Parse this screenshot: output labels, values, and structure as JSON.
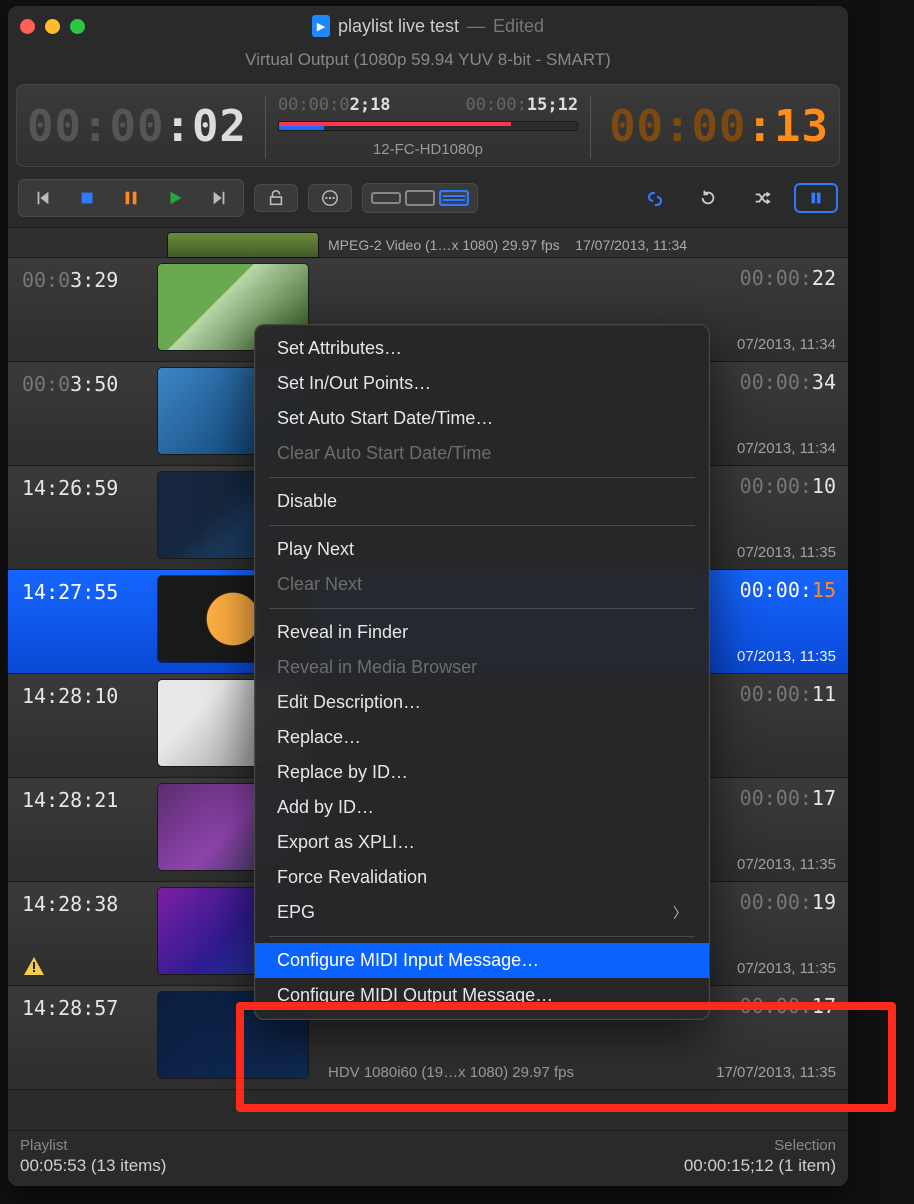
{
  "window": {
    "doc_name": "playlist live test",
    "edited": "Edited",
    "subtitle": "Virtual Output (1080p 59.94 YUV 8-bit - SMART)"
  },
  "timecode": {
    "left_dim": "00:00",
    "left_bright": ":02",
    "in_dim": "00:00:0",
    "in_bright": "2;18",
    "out_dim": "00:00:",
    "out_bright": "15;12",
    "right_dim": "00:00",
    "right_bright": ":13",
    "clip_name": "12-FC-HD1080p"
  },
  "toolbar": {
    "prev": "⏮",
    "stop": "■",
    "pause": "⏸",
    "play": "▶",
    "next": "⏭",
    "lock": "🔓",
    "more": "⋯",
    "link": "link",
    "reload": "↻",
    "shuffle": "⤨",
    "chain_pause": "⏸"
  },
  "partial_row": {
    "meta": "MPEG-2 Video (1…x 1080) 29.97 fps",
    "date": "17/07/2013, 11:34"
  },
  "rows": [
    {
      "start_dim": "00:0",
      "start_bright": "3:29",
      "dur_dim": "00:00:",
      "dur_bright": "22",
      "codec": "",
      "date": "07/2013, 11:34",
      "thumb": "th-a"
    },
    {
      "start_dim": "00:0",
      "start_bright": "3:50",
      "dur_dim": "00:00:",
      "dur_bright": "34",
      "codec": "",
      "date": "07/2013, 11:34",
      "thumb": "th-b"
    },
    {
      "start_dim": "",
      "start_bright": "14:26:59",
      "dur_dim": "00:00:",
      "dur_bright": "10",
      "codec": "",
      "date": "07/2013, 11:35",
      "thumb": "th-c"
    },
    {
      "start_dim": "",
      "start_bright": "14:27:55",
      "dur_dim": "00:00:",
      "dur_bright": "15",
      "dur_style": "orange",
      "codec": "",
      "date": "07/2013, 11:35",
      "thumb": "th-d",
      "selected": true
    },
    {
      "start_dim": "",
      "start_bright": "14:28:10",
      "dur_dim": "00:00:",
      "dur_bright": "11",
      "codec": "",
      "date": "",
      "thumb": "th-e"
    },
    {
      "start_dim": "",
      "start_bright": "14:28:21",
      "dur_dim": "00:00:",
      "dur_bright": "17",
      "codec": "",
      "date": "07/2013, 11:35",
      "thumb": "th-f"
    },
    {
      "start_dim": "",
      "start_bright": "14:28:38",
      "dur_dim": "00:00:",
      "dur_bright": "19",
      "codec": "",
      "date": "07/2013, 11:35",
      "thumb": "th-g",
      "warn": true
    },
    {
      "start_dim": "",
      "start_bright": "14:28:57",
      "dur_dim": "00:00:",
      "dur_bright": "17",
      "codec": "HDV 1080i60 (19…x 1080) 29.97 fps",
      "date": "17/07/2013, 11:35",
      "thumb": "th-h"
    }
  ],
  "context_menu": [
    {
      "label": "Set Attributes…"
    },
    {
      "label": "Set In/Out Points…"
    },
    {
      "label": "Set Auto Start Date/Time…"
    },
    {
      "label": "Clear Auto Start Date/Time",
      "disabled": true
    },
    {
      "sep": true
    },
    {
      "label": "Disable"
    },
    {
      "sep": true
    },
    {
      "label": "Play Next"
    },
    {
      "label": "Clear Next",
      "disabled": true
    },
    {
      "sep": true
    },
    {
      "label": "Reveal in Finder"
    },
    {
      "label": "Reveal in Media Browser",
      "disabled": true
    },
    {
      "label": "Edit Description…"
    },
    {
      "label": "Replace…"
    },
    {
      "label": "Replace by ID…"
    },
    {
      "label": "Add by ID…"
    },
    {
      "label": "Export as XPLI…"
    },
    {
      "label": "Force Revalidation"
    },
    {
      "label": "EPG",
      "submenu": true
    },
    {
      "sep": true
    },
    {
      "label": "Configure MIDI Input Message…",
      "selected": true
    },
    {
      "label": "Configure MIDI Output Message…"
    }
  ],
  "footer": {
    "left_label": "Playlist",
    "left_value": "00:05:53 (13 items)",
    "right_label": "Selection",
    "right_value": "00:00:15;12 (1 item)"
  }
}
